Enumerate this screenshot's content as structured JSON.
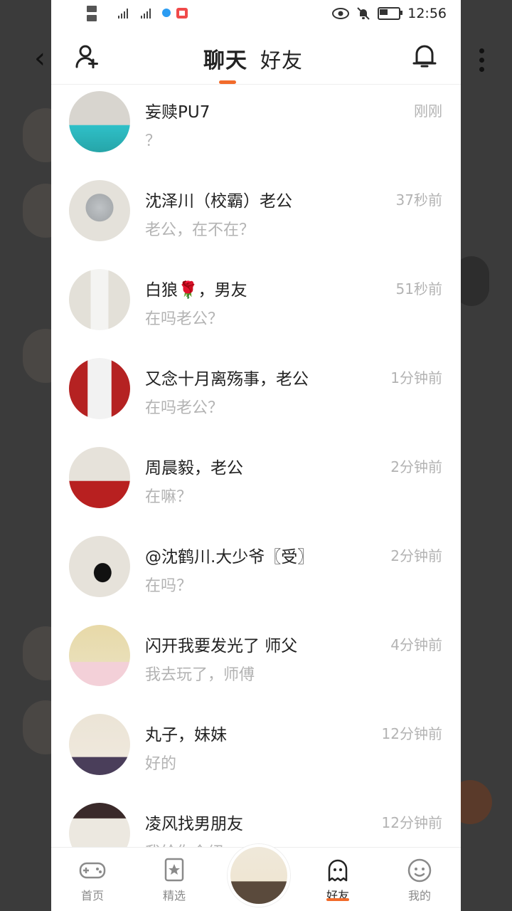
{
  "status_bar": {
    "time": "12:56",
    "battery_level": 0.45
  },
  "header": {
    "tabs": [
      "聊天",
      "好友"
    ],
    "active_tab": 0
  },
  "chats": [
    {
      "name": "妄赎PU7",
      "message": "？",
      "time": "刚刚"
    },
    {
      "name": "沈泽川（校霸）老公",
      "message": "老公，在不在？",
      "time": "37秒前"
    },
    {
      "name": "白狼🌹，男友",
      "message": "在吗老公？",
      "time": "51秒前"
    },
    {
      "name": "又念十月离殇事，老公",
      "message": "在吗老公？",
      "time": "1分钟前"
    },
    {
      "name": "周晨毅，老公",
      "message": "在嘛？",
      "time": "2分钟前"
    },
    {
      "name": "@沈鹤川.大少爷〖受〗",
      "message": "在吗？",
      "time": "2分钟前"
    },
    {
      "name": "闪开我要发光了 师父",
      "message": "我去玩了，师傅",
      "time": "4分钟前"
    },
    {
      "name": "丸子，妹妹",
      "message": "好的",
      "time": "12分钟前"
    },
    {
      "name": "凌风找男朋友",
      "message": "我给你介绍",
      "time": "12分钟前"
    }
  ],
  "bottom_nav": [
    {
      "label": "首页",
      "icon": "gamepad-icon"
    },
    {
      "label": "精选",
      "icon": "star-bookmark-icon"
    },
    {
      "label": "好友",
      "icon": "ghost-icon"
    },
    {
      "label": "我的",
      "icon": "smiley-icon"
    }
  ],
  "colors": {
    "accent": "#f26b2b"
  }
}
